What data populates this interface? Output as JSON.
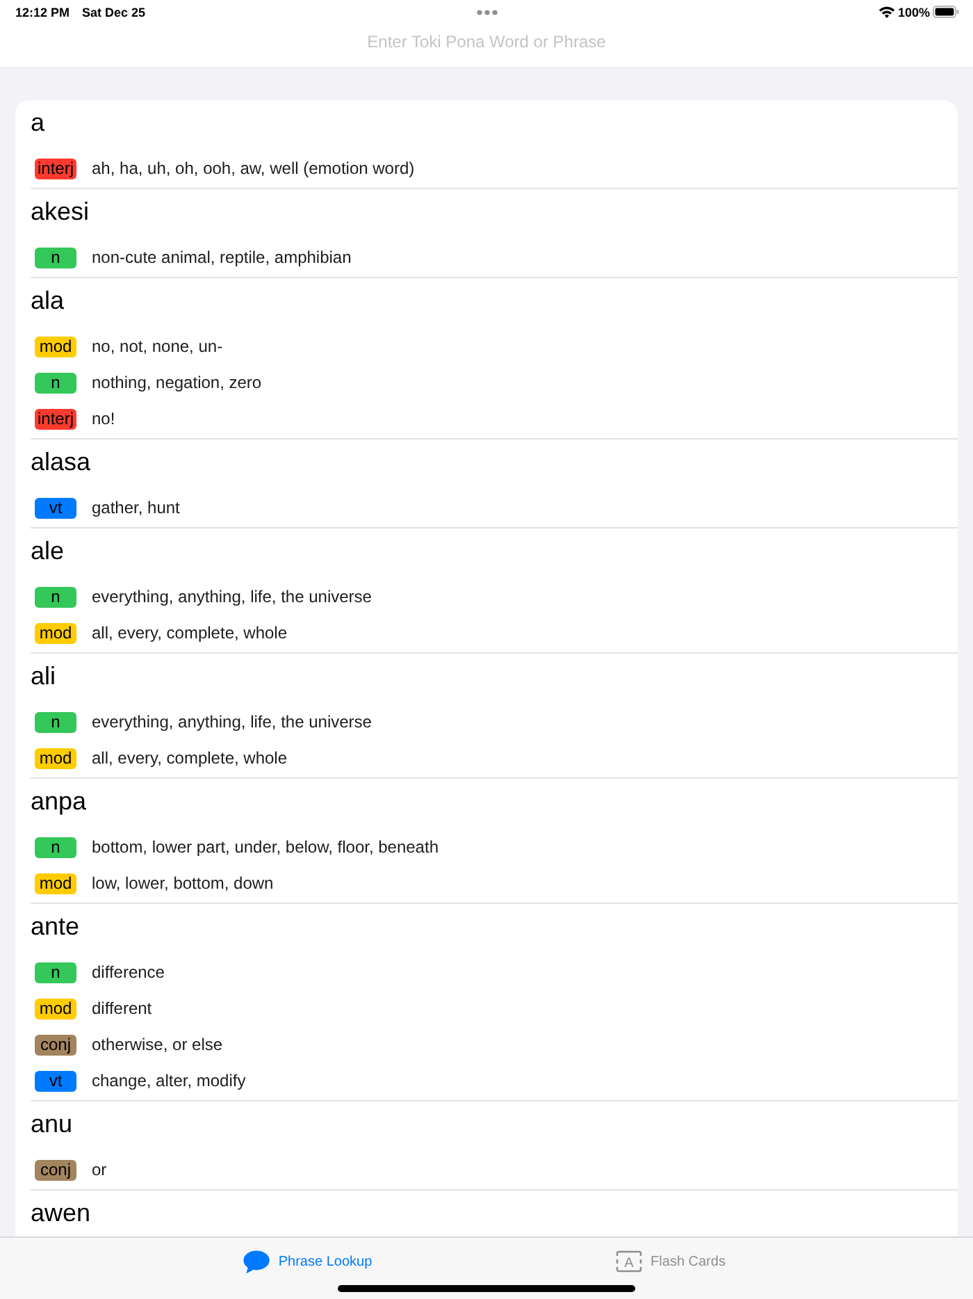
{
  "status_bar": {
    "time": "12:12 PM",
    "date": "Sat Dec 25",
    "battery": "100%"
  },
  "search": {
    "placeholder": "Enter Toki Pona Word or Phrase"
  },
  "entries": [
    {
      "word": "a",
      "definitions": [
        {
          "pos": "interj",
          "color": "#ff3b30",
          "text": "ah, ha, uh, oh, ooh, aw, well (emotion word)"
        }
      ]
    },
    {
      "word": "akesi",
      "definitions": [
        {
          "pos": "n",
          "color": "#34c759",
          "text": "non-cute animal, reptile, amphibian"
        }
      ]
    },
    {
      "word": "ala",
      "definitions": [
        {
          "pos": "mod",
          "color": "#ffcc00",
          "text": "no, not, none, un-"
        },
        {
          "pos": "n",
          "color": "#34c759",
          "text": "nothing, negation, zero"
        },
        {
          "pos": "interj",
          "color": "#ff3b30",
          "text": "no!"
        }
      ]
    },
    {
      "word": "alasa",
      "definitions": [
        {
          "pos": "vt",
          "color": "#007aff",
          "text": "gather, hunt"
        }
      ]
    },
    {
      "word": "ale",
      "definitions": [
        {
          "pos": "n",
          "color": "#34c759",
          "text": "everything, anything, life, the universe"
        },
        {
          "pos": "mod",
          "color": "#ffcc00",
          "text": "all, every, complete, whole"
        }
      ]
    },
    {
      "word": "ali",
      "definitions": [
        {
          "pos": "n",
          "color": "#34c759",
          "text": "everything, anything, life, the universe"
        },
        {
          "pos": "mod",
          "color": "#ffcc00",
          "text": "all, every, complete, whole"
        }
      ]
    },
    {
      "word": "anpa",
      "definitions": [
        {
          "pos": "n",
          "color": "#34c759",
          "text": "bottom, lower part, under, below, floor, beneath"
        },
        {
          "pos": "mod",
          "color": "#ffcc00",
          "text": "low, lower, bottom, down"
        }
      ]
    },
    {
      "word": "ante",
      "definitions": [
        {
          "pos": "n",
          "color": "#34c759",
          "text": "difference"
        },
        {
          "pos": "mod",
          "color": "#ffcc00",
          "text": "different"
        },
        {
          "pos": "conj",
          "color": "#a2845e",
          "text": "otherwise, or else"
        },
        {
          "pos": "vt",
          "color": "#007aff",
          "text": "change, alter, modify"
        }
      ]
    },
    {
      "word": "anu",
      "definitions": [
        {
          "pos": "conj",
          "color": "#a2845e",
          "text": "or"
        }
      ]
    },
    {
      "word": "awen"
    }
  ],
  "tab_bar": {
    "tabs": [
      {
        "label": "Phrase Lookup",
        "selected": true
      },
      {
        "label": "Flash Cards",
        "selected": false,
        "icon_letter": "A"
      }
    ]
  }
}
